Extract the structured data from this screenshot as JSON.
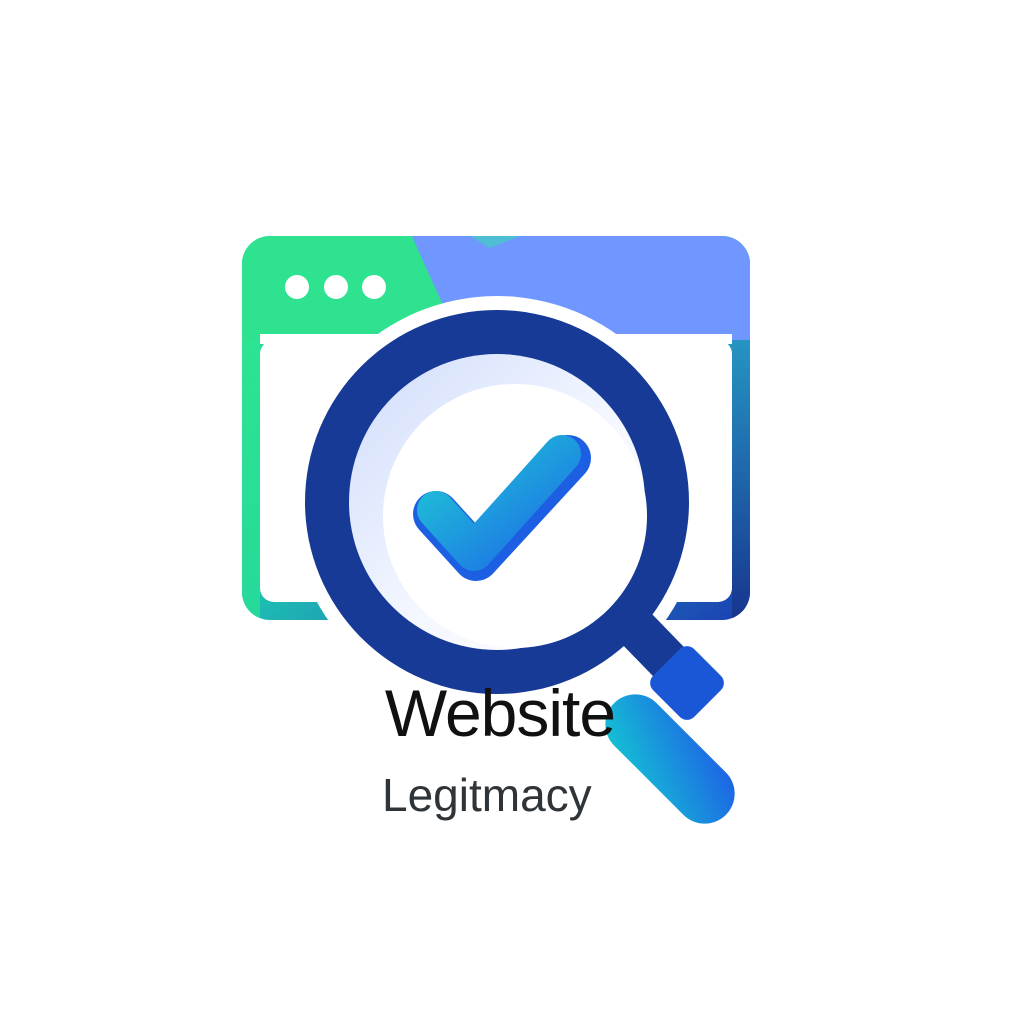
{
  "logo": {
    "title": "Website",
    "subtitle": "Legitmacy",
    "icons": {
      "window": "browser-window-icon",
      "dots": "window-dots-icon",
      "magnifier": "magnifying-glass-icon",
      "check": "checkmark-icon"
    },
    "colors": {
      "background": "#ffffff",
      "green": "#2ee58f",
      "teal": "#17b6c9",
      "periwinkle": "#6f97ff",
      "navy": "#163a96",
      "bright_blue": "#1f66e6",
      "cyan": "#15c1d6",
      "title_text": "#111111",
      "subtitle_text": "#2f3438"
    }
  }
}
